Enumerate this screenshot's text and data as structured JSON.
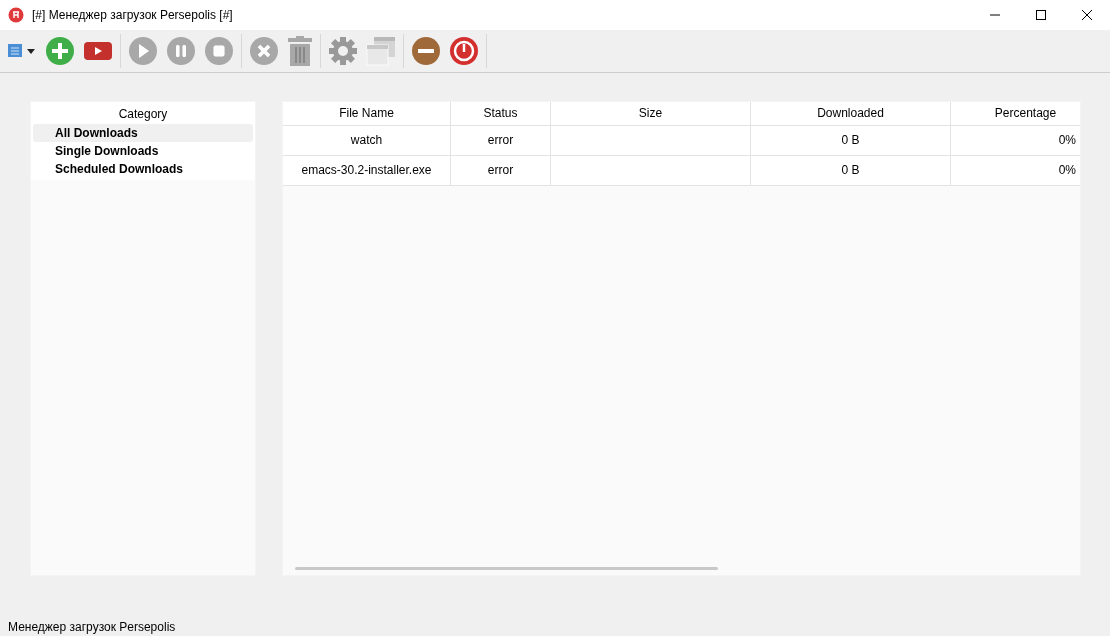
{
  "window": {
    "title": "[#] Менеджер загрузок Persepolis [#]"
  },
  "toolbar": [
    {
      "kind": "menu",
      "disabled": false
    },
    {
      "kind": "add",
      "disabled": false
    },
    {
      "kind": "video",
      "disabled": false
    },
    {
      "kind": "sep"
    },
    {
      "kind": "resume",
      "disabled": true
    },
    {
      "kind": "pause",
      "disabled": true
    },
    {
      "kind": "stop",
      "disabled": true
    },
    {
      "kind": "sep"
    },
    {
      "kind": "remove",
      "disabled": true
    },
    {
      "kind": "delete",
      "disabled": true
    },
    {
      "kind": "sep"
    },
    {
      "kind": "settings",
      "disabled": false
    },
    {
      "kind": "windows",
      "disabled": true
    },
    {
      "kind": "sep"
    },
    {
      "kind": "minimize",
      "disabled": false
    },
    {
      "kind": "exit",
      "disabled": false
    },
    {
      "kind": "sep"
    }
  ],
  "sidebar": {
    "title": "Category",
    "items": [
      {
        "label": "All Downloads",
        "selected": true
      },
      {
        "label": "Single Downloads",
        "selected": false
      },
      {
        "label": "Scheduled Downloads",
        "selected": false
      }
    ]
  },
  "table": {
    "columns": [
      "File Name",
      "Status",
      "Size",
      "Downloaded",
      "Percentage"
    ],
    "rows": [
      [
        "watch",
        "error",
        "",
        "0 B",
        "0%"
      ],
      [
        "emacs-30.2-installer.exe",
        "error",
        "",
        "0 B",
        "0%"
      ]
    ]
  },
  "status_bar": "Менеджер загрузок Persepolis"
}
